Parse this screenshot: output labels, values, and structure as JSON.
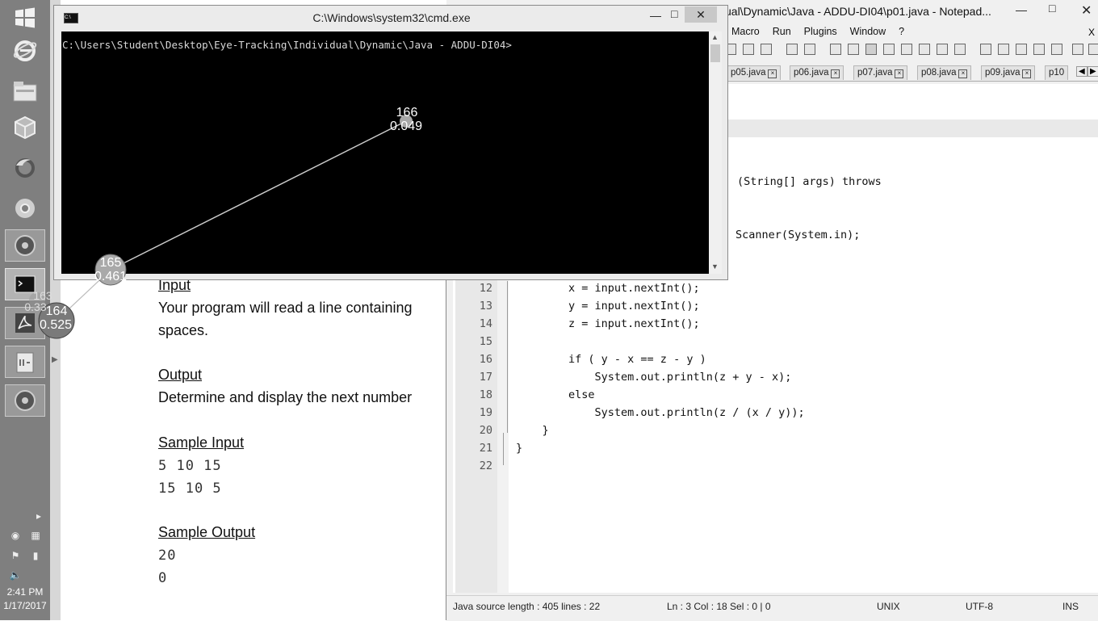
{
  "taskbar": {
    "clock_time": "2:41 PM",
    "clock_date": "1/17/2017",
    "apps": [
      "windows-start",
      "internet-explorer",
      "file-explorer",
      "virtualbox",
      "firefox",
      "chrome",
      "media-app-1",
      "cmd",
      "acrobat",
      "editor",
      "media-app-2"
    ]
  },
  "document": {
    "input_heading": "Input",
    "input_text_1": "Your program will read a line containing",
    "input_text_2": "spaces.",
    "output_heading": "Output",
    "output_text_1": "Determine and display the next number",
    "sample_input_heading": "Sample Input",
    "sample_input_lines": [
      "5 10 15",
      "15 10 5"
    ],
    "sample_output_heading": "Sample Output",
    "sample_output_lines": [
      "20",
      "0"
    ]
  },
  "notepad": {
    "title": "ual\\Dynamic\\Java - ADDU-DI04\\p01.java - Notepad...",
    "menu": [
      "Macro",
      "Run",
      "Plugins",
      "Window",
      "?"
    ],
    "tabs": [
      "p05.java",
      "p06.java",
      "p07.java",
      "p08.java",
      "p09.java",
      "p10"
    ],
    "partial_code": [
      "(String[] args) throws",
      "Scanner(System.in);"
    ],
    "lines": [
      {
        "n": "12",
        "code": "        x = input.nextInt();"
      },
      {
        "n": "13",
        "code": "        y = input.nextInt();"
      },
      {
        "n": "14",
        "code": "        z = input.nextInt();"
      },
      {
        "n": "15",
        "code": ""
      },
      {
        "n": "16",
        "code": "        if ( y - x == z - y )"
      },
      {
        "n": "17",
        "code": "            System.out.println(z + y - x);"
      },
      {
        "n": "18",
        "code": "        else"
      },
      {
        "n": "19",
        "code": "            System.out.println(z / (x / y));"
      },
      {
        "n": "20",
        "code": "    }"
      },
      {
        "n": "21",
        "code": "}"
      },
      {
        "n": "22",
        "code": ""
      }
    ],
    "status": {
      "file_info": "Java source length : 405    lines : 22",
      "position": "Ln : 3    Col : 18    Sel : 0 | 0",
      "eol": "UNIX",
      "encoding": "UTF-8",
      "mode": "INS"
    }
  },
  "cmd": {
    "title": "C:\\Windows\\system32\\cmd.exe",
    "prompt": "C:\\Users\\Student\\Desktop\\Eye-Tracking\\Individual\\Dynamic\\Java - ADDU-DI04>",
    "icon_label": "C:\\"
  },
  "gaze": {
    "fixations": [
      {
        "id": "166",
        "value": "0.049"
      },
      {
        "id": "165",
        "value": "0.461"
      },
      {
        "id": "163",
        "value": "0.33"
      },
      {
        "id": "164",
        "value": "0.525"
      }
    ]
  }
}
